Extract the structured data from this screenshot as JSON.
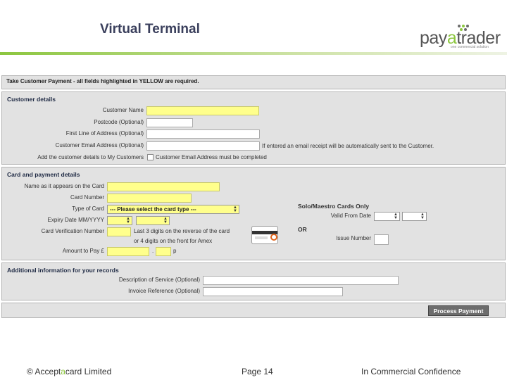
{
  "slide": {
    "title": "Virtual Terminal"
  },
  "logo": {
    "text_pre": "pay",
    "text_accent": "a",
    "text_post": "trader",
    "tagline": "one commercial solution"
  },
  "header_bar": {
    "text": "Take Customer Payment - all fields highlighted in YELLOW are required."
  },
  "customer": {
    "title": "Customer details",
    "name_label": "Customer Name",
    "postcode_label": "Postcode (Optional)",
    "address_label": "First Line of Address (Optional)",
    "email_label": "Customer Email Address (Optional)",
    "email_note": "If entered an email receipt will be automatically sent to the Customer.",
    "add_label": "Add the customer details to My Customers",
    "add_note": "Customer Email Address must be completed"
  },
  "card": {
    "title": "Card and payment details",
    "name_label": "Name as it appears on the Card",
    "number_label": "Card Number",
    "type_label": "Type of Card",
    "type_value": "--- Please select the card type ---",
    "expiry_label": "Expiry Date MM/YYYY",
    "cvn_label": "Card Verification Number",
    "cvn_hint_1": "Last 3 digits on the reverse of the card",
    "cvn_hint_2": "or 4 digits on the front for Amex",
    "amount_label": "Amount to Pay £",
    "amount_sep": ".",
    "amount_suffix": "p",
    "solo_title": "Solo/Maestro Cards Only",
    "valid_from_label": "Valid From Date",
    "or_label": "OR",
    "issue_label": "Issue Number"
  },
  "additional": {
    "title": "Additional information for your records",
    "description_label": "Description of Service (Optional)",
    "invoice_label": "Invoice Reference (Optional)"
  },
  "actions": {
    "process_label": "Process Payment"
  },
  "footer": {
    "copyright_pre": "© Accept",
    "copyright_accent": "a",
    "copyright_post": "card Limited",
    "page": "Page 14",
    "confidential": "In Commercial Confidence"
  },
  "colors": {
    "accent_green": "#8cc63f",
    "required_yellow": "#ffff8c",
    "panel_grey": "#e2e2e2"
  }
}
